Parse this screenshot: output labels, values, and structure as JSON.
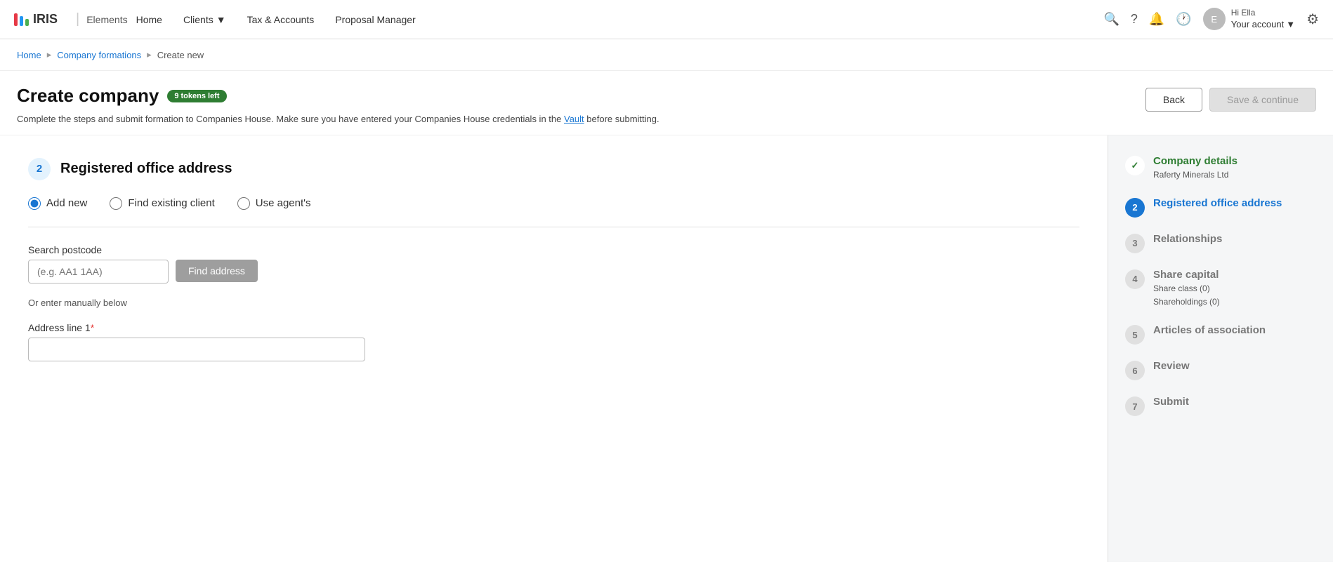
{
  "navbar": {
    "logo_text": "IRIS",
    "logo_elements": "Elements",
    "nav_items": [
      {
        "label": "Home",
        "id": "home"
      },
      {
        "label": "Clients",
        "id": "clients",
        "has_arrow": true
      },
      {
        "label": "Tax & Accounts",
        "id": "tax-accounts"
      },
      {
        "label": "Proposal Manager",
        "id": "proposal-manager"
      }
    ],
    "user_greeting": "Hi Ella",
    "user_account": "Your account",
    "settings_title": "Settings"
  },
  "breadcrumb": {
    "home": "Home",
    "company_formations": "Company formations",
    "current": "Create new"
  },
  "page": {
    "title": "Create company",
    "tokens_badge": "9 tokens left",
    "description_before": "Complete the steps and submit formation to Companies House. Make sure you have entered your Companies House credentials in the ",
    "vault_link": "Vault",
    "description_after": " before submitting.",
    "back_button": "Back",
    "save_button": "Save & continue"
  },
  "step": {
    "number": "2",
    "title": "Registered office address",
    "radio_options": [
      {
        "id": "add-new",
        "label": "Add new",
        "checked": true
      },
      {
        "id": "find-existing",
        "label": "Find existing client",
        "checked": false
      },
      {
        "id": "use-agents",
        "label": "Use agent's",
        "checked": false
      }
    ]
  },
  "form": {
    "postcode_label": "Search postcode",
    "postcode_placeholder": "(e.g. AA1 1AA)",
    "find_address_button": "Find address",
    "manual_hint": "Or enter manually below",
    "address_line1_label": "Address line 1",
    "required_marker": "*"
  },
  "sidebar": {
    "steps": [
      {
        "id": 1,
        "status": "completed",
        "label": "Company details",
        "sub": [
          "Raferty Minerals Ltd"
        ]
      },
      {
        "id": 2,
        "status": "active",
        "label": "Registered office address",
        "sub": []
      },
      {
        "id": 3,
        "status": "inactive",
        "label": "Relationships",
        "sub": []
      },
      {
        "id": 4,
        "status": "inactive",
        "label": "Share capital",
        "sub": [
          "Share class (0)",
          "Shareholdings (0)"
        ]
      },
      {
        "id": 5,
        "status": "inactive",
        "label": "Articles of association",
        "sub": []
      },
      {
        "id": 6,
        "status": "inactive",
        "label": "Review",
        "sub": []
      },
      {
        "id": 7,
        "status": "inactive",
        "label": "Submit",
        "sub": []
      }
    ]
  }
}
